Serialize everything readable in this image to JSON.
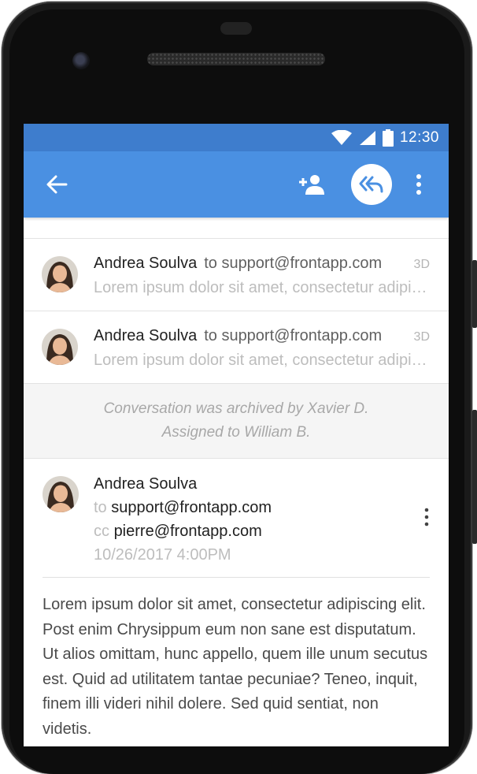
{
  "status_bar": {
    "time": "12:30"
  },
  "app_bar": {
    "icons": [
      "back-arrow-icon",
      "add-person-icon",
      "reply-all-icon",
      "more-vert-icon"
    ],
    "colors": {
      "primary": "#4a90e2",
      "status": "#3e7dcd"
    }
  },
  "messages": [
    {
      "sender": "Andrea Soulva",
      "to": "to support@frontapp.com",
      "age": "3D",
      "snippet": "Lorem ipsum dolor sit amet, consectetur adipiscing elit. Post enim Chrysippum eum non sane est"
    },
    {
      "sender": "Andrea Soulva",
      "to": "to support@frontapp.com",
      "age": "3D",
      "snippet": "Lorem ipsum dolor sit amet, consectetur adipiscing elit. Post enim Chrysippum eum non sane est"
    }
  ],
  "system_note": {
    "line1": "Conversation was archived by Xavier D.",
    "line2": "Assigned to William B."
  },
  "open_message": {
    "sender": "Andrea Soulva",
    "to_label": "to",
    "to_address": "support@frontapp.com",
    "cc_label": "cc",
    "cc_address": "pierre@frontapp.com",
    "date": "10/26/2017 4:00PM",
    "body": "Lorem ipsum dolor sit amet, consectetur adipiscing elit. Post enim Chrysippum eum non sane est disputatum. Ut alios omittam, hunc appello, quem ille unum secutus est. Quid ad utilitatem tantae pecuniae? Teneo, inquit, finem illi videri nihil dolere. Sed quid sentiat, non videtis."
  }
}
